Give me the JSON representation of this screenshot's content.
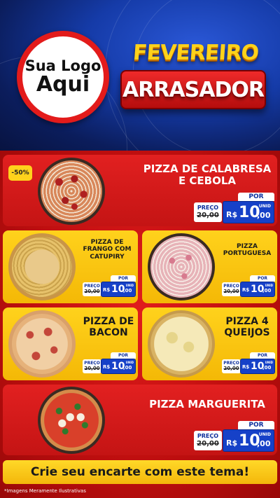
{
  "header": {
    "logo_line1": "Sua Logo",
    "logo_line2": "Aqui",
    "title_top": "FEVEREIRO",
    "title_bottom": "ARRASADOR"
  },
  "labels": {
    "preco": "PREÇO",
    "por": "POR",
    "currency": "R$",
    "unit": "UNID"
  },
  "products": [
    {
      "name": "PIZZA DE CALABRESA E CEBOLA",
      "badge": "-50%",
      "old_price": "20,00",
      "price_int": "10",
      "price_dec": ",00",
      "style": "calabresa"
    },
    {
      "name": "PIZZA DE FRANGO COM CATUPIRY",
      "old_price": "20,00",
      "price_int": "10",
      "price_dec": ",00",
      "style": "frango"
    },
    {
      "name": "PIZZA PORTUGUESA",
      "old_price": "20,00",
      "price_int": "10",
      "price_dec": ",00",
      "style": "portuguesa"
    },
    {
      "name": "PIZZA DE BACON",
      "old_price": "20,00",
      "price_int": "10",
      "price_dec": ",00",
      "style": "bacon"
    },
    {
      "name": "PIZZA 4 QUEIJOS",
      "old_price": "20,00",
      "price_int": "10",
      "price_dec": ",00",
      "style": "queijos"
    },
    {
      "name": "PIZZA MARGUERITA",
      "old_price": "20,00",
      "price_int": "10",
      "price_dec": ",00",
      "style": "marguerita"
    }
  ],
  "cta": "Crie seu encarte com este tema!",
  "footnote": "*Imagens Meramente Ilustrativas",
  "colors": {
    "red": "#d81818",
    "yellow": "#ffcc14",
    "blue": "#1641c8",
    "navy": "#0b1d5c"
  }
}
